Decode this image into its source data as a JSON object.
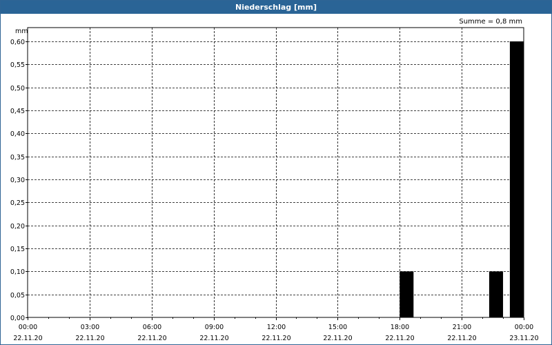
{
  "title": "Niederschlag [mm]",
  "sum_label": "Summe = 0,8 mm",
  "chart_data": {
    "type": "bar",
    "title": "Niederschlag [mm]",
    "ylabel": "mm",
    "xlabel": "",
    "ylim": [
      0,
      0.6
    ],
    "xlim_hours": [
      0,
      24
    ],
    "y_ticks": [
      "0,00",
      "0,05",
      "0,10",
      "0,15",
      "0,20",
      "0,25",
      "0,30",
      "0,35",
      "0,40",
      "0,45",
      "0,50",
      "0,55",
      "0,60"
    ],
    "x_ticks": [
      {
        "time": "00:00",
        "date": "22.11.20"
      },
      {
        "time": "03:00",
        "date": "22.11.20"
      },
      {
        "time": "06:00",
        "date": "22.11.20"
      },
      {
        "time": "09:00",
        "date": "22.11.20"
      },
      {
        "time": "12:00",
        "date": "22.11.20"
      },
      {
        "time": "15:00",
        "date": "22.11.20"
      },
      {
        "time": "18:00",
        "date": "22.11.20"
      },
      {
        "time": "21:00",
        "date": "22.11.20"
      },
      {
        "time": "00:00",
        "date": "23.11.20"
      }
    ],
    "bars": [
      {
        "start_hour": 18.0,
        "end_hour": 18.67,
        "value": 0.1
      },
      {
        "start_hour": 22.33,
        "end_hour": 23.0,
        "value": 0.1
      },
      {
        "start_hour": 23.33,
        "end_hour": 24.0,
        "value": 0.6
      }
    ],
    "grid": true,
    "colors": {
      "bar": "#000000",
      "grid": "#000000",
      "header": "#2a6496"
    }
  }
}
